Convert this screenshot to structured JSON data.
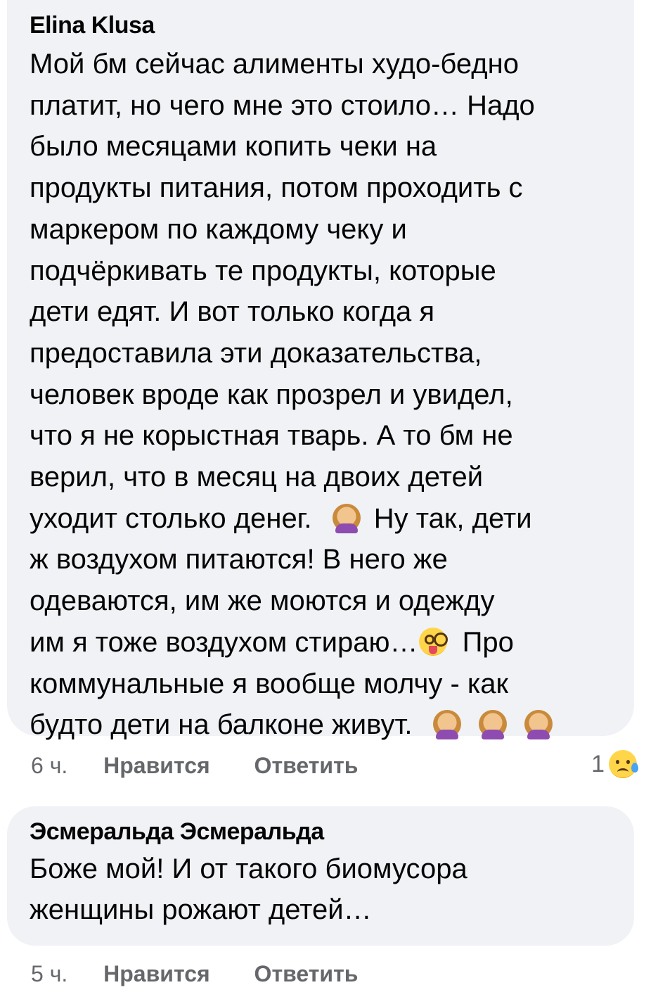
{
  "comments": [
    {
      "author": "Elina Klusa",
      "lines": [
        "Мой бм сейчас алименты худо-бедно",
        "платит, но чего мне это стоило… Надо",
        "было месяцами копить чеки на",
        "продукты питания, потом проходить с",
        "маркером по каждому чеку и",
        "подчёркивать те продукты, которые",
        "дети едят. И вот только когда я",
        "предоставила эти доказательства,",
        "человек вроде как прозрел и увидел,",
        "что я не корыстная тварь. А то бм не",
        "верил, что в месяц на двоих детей",
        "уходит столько денег.",
        "Ну так, дети",
        "ж воздухом питаются! В него же",
        "одеваются, им же моются и одежду",
        "им я тоже воздухом стираю…",
        "Про",
        "коммунальные я вообще молчу - как",
        "будто дети на балконе живут."
      ],
      "emojis": {
        "facepalm": "facepalm-emoji",
        "dizzy": "dizzy-face-emoji"
      },
      "time": "6 ч.",
      "like_label": "Нравится",
      "reply_label": "Ответить",
      "reaction_count": "1",
      "reaction_icon": "sad-face-icon"
    },
    {
      "author": "Эсмеральда Эсмеральда",
      "lines": [
        "Боже мой! И от такого биомусора",
        "женщины рожают детей…"
      ],
      "time": "5 ч.",
      "like_label": "Нравится",
      "reply_label": "Ответить"
    }
  ]
}
